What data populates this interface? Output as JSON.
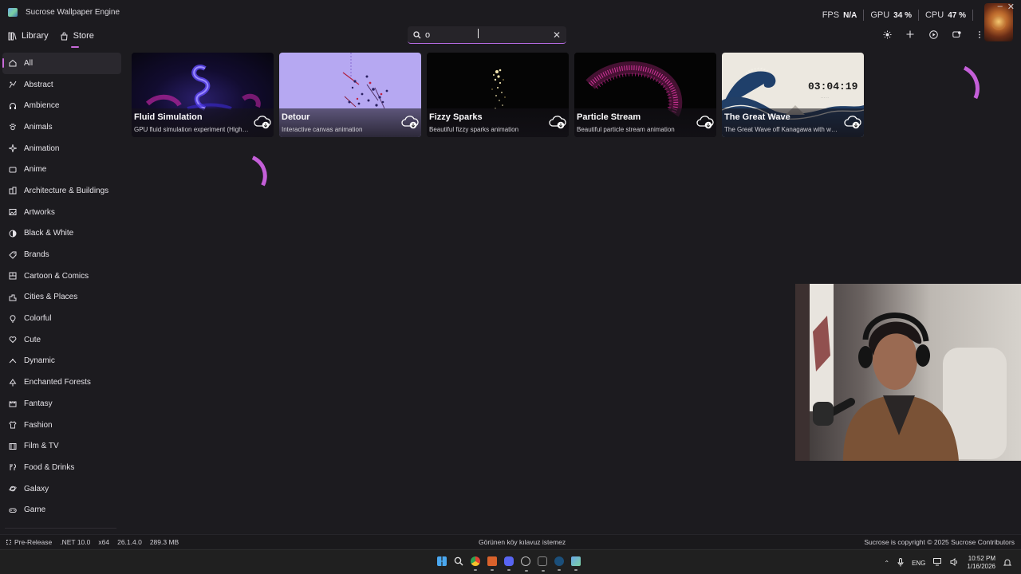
{
  "app": {
    "title": "Sucrose Wallpaper Engine"
  },
  "stats": {
    "fps_label": "FPS",
    "fps_value": "N/A",
    "gpu_label": "GPU",
    "gpu_value": "34 %",
    "cpu_label": "CPU",
    "cpu_value": "47 %"
  },
  "nav": {
    "library_label": "Library",
    "store_label": "Store",
    "active": "Store"
  },
  "search": {
    "value": "o",
    "placeholder": ""
  },
  "toolbar": {
    "icons": [
      "theme-icon",
      "add-icon",
      "play-icon",
      "display-icon",
      "more-icon"
    ]
  },
  "sidebar": {
    "items": [
      {
        "label": "All",
        "icon": "home-icon"
      },
      {
        "label": "Abstract",
        "icon": "abstract-icon"
      },
      {
        "label": "Ambience",
        "icon": "headphones-icon"
      },
      {
        "label": "Animals",
        "icon": "paw-icon"
      },
      {
        "label": "Animation",
        "icon": "sparkle-icon"
      },
      {
        "label": "Anime",
        "icon": "screen-icon"
      },
      {
        "label": "Architecture & Buildings",
        "icon": "building-icon"
      },
      {
        "label": "Artworks",
        "icon": "image-icon"
      },
      {
        "label": "Black & White",
        "icon": "contrast-icon"
      },
      {
        "label": "Brands",
        "icon": "tag-icon"
      },
      {
        "label": "Cartoon & Comics",
        "icon": "comic-icon"
      },
      {
        "label": "Cities & Places",
        "icon": "city-icon"
      },
      {
        "label": "Colorful",
        "icon": "bulb-icon"
      },
      {
        "label": "Cute",
        "icon": "heart-icon"
      },
      {
        "label": "Dynamic",
        "icon": "dynamic-icon"
      },
      {
        "label": "Enchanted Forests",
        "icon": "tree-icon"
      },
      {
        "label": "Fantasy",
        "icon": "castle-icon"
      },
      {
        "label": "Fashion",
        "icon": "shirt-icon"
      },
      {
        "label": "Film & TV",
        "icon": "film-icon"
      },
      {
        "label": "Food & Drinks",
        "icon": "food-icon"
      },
      {
        "label": "Galaxy",
        "icon": "planet-icon"
      },
      {
        "label": "Game",
        "icon": "gamepad-icon"
      }
    ]
  },
  "cards": [
    {
      "title": "Fluid Simulation",
      "description": "GPU fluid simulation experiment (High quality)"
    },
    {
      "title": "Detour",
      "description": "Interactive canvas animation"
    },
    {
      "title": "Fizzy Sparks",
      "description": "Beautiful fizzy sparks animation"
    },
    {
      "title": "Particle Stream",
      "description": "Beautiful particle stream animation"
    },
    {
      "title": "The Great Wave",
      "description": "The Great Wave off Kanagawa with watch",
      "clock": "03:04:19"
    }
  ],
  "statusbar": {
    "channel": "Pre-Release",
    "runtime": ".NET 10.0",
    "arch": "x64",
    "version": "26.1.4.0",
    "memory": "289.3 MB",
    "center_text": "Görünen köy kılavuz istemez",
    "copyright": "Sucrose is copyright © 2025 Sucrose Contributors"
  },
  "taskbar": {
    "tray_lang": "ENG",
    "time": "10:52 PM",
    "date": "1/16/2026"
  },
  "colors": {
    "accent": "#c86ad8",
    "background": "#1c1b1f",
    "spinner": "#c45fd8"
  }
}
